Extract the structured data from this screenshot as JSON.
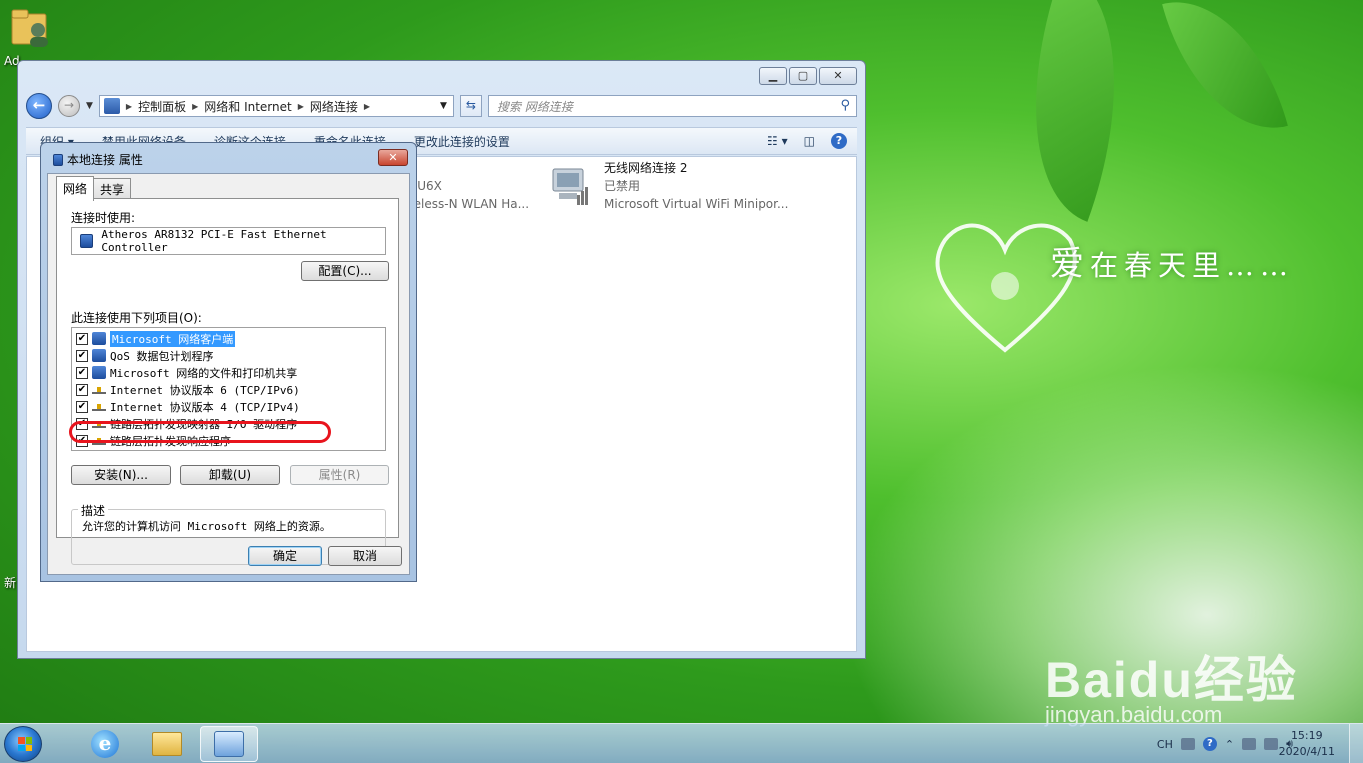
{
  "desktop": {
    "icon_label": "Ad",
    "icon_label2": "新",
    "wallpaper_text_big": "爱",
    "wallpaper_text": "在春天里……",
    "watermark": "Baidu经验",
    "watermark_sub": "jingyan.baidu.com"
  },
  "explorer": {
    "breadcrumb": [
      "控制面板",
      "网络和 Internet",
      "网络连接"
    ],
    "search_placeholder": "搜索 网络连接",
    "toolbar": [
      "组织 ▾",
      "禁用此网络设备",
      "诊断这个连接",
      "重命名此连接",
      "更改此连接的设置"
    ],
    "connections": [
      {
        "name": "",
        "line2": "AU6X",
        "line3": "reless-N WLAN Ha..."
      },
      {
        "name": "无线网络连接 2",
        "line2": "已禁用",
        "line3": "Microsoft Virtual WiFi Minipor..."
      }
    ]
  },
  "dialog": {
    "title": "本地连接 属性",
    "tabs": [
      "网络",
      "共享"
    ],
    "connect_using_label": "连接时使用:",
    "adapter": "Atheros AR8132 PCI-E Fast Ethernet Controller",
    "configure_button": "配置(C)...",
    "items_label": "此连接使用下列项目(O):",
    "items": [
      {
        "label": "Microsoft 网络客户端",
        "checked": true,
        "icon": "network-client-icon",
        "selected": true
      },
      {
        "label": "QoS 数据包计划程序",
        "checked": true,
        "icon": "network-client-icon"
      },
      {
        "label": "Microsoft 网络的文件和打印机共享",
        "checked": true,
        "icon": "network-client-icon"
      },
      {
        "label": "Internet 协议版本 6 (TCP/IPv6)",
        "checked": true,
        "icon": "protocol-icon"
      },
      {
        "label": "Internet 协议版本 4 (TCP/IPv4)",
        "checked": true,
        "icon": "protocol-icon"
      },
      {
        "label": "链路层拓扑发现映射器 I/O 驱动程序",
        "checked": true,
        "icon": "protocol-icon"
      },
      {
        "label": "链路层拓扑发现响应程序",
        "checked": true,
        "icon": "protocol-icon"
      }
    ],
    "install_button": "安装(N)...",
    "uninstall_button": "卸载(U)",
    "properties_button": "属性(R)",
    "description_label": "描述",
    "description_text": "允许您的计算机访问 Microsoft 网络上的资源。",
    "ok_button": "确定",
    "cancel_button": "取消"
  },
  "taskbar": {
    "lang": "CH",
    "time": "15:19",
    "date": "2020/4/11"
  }
}
